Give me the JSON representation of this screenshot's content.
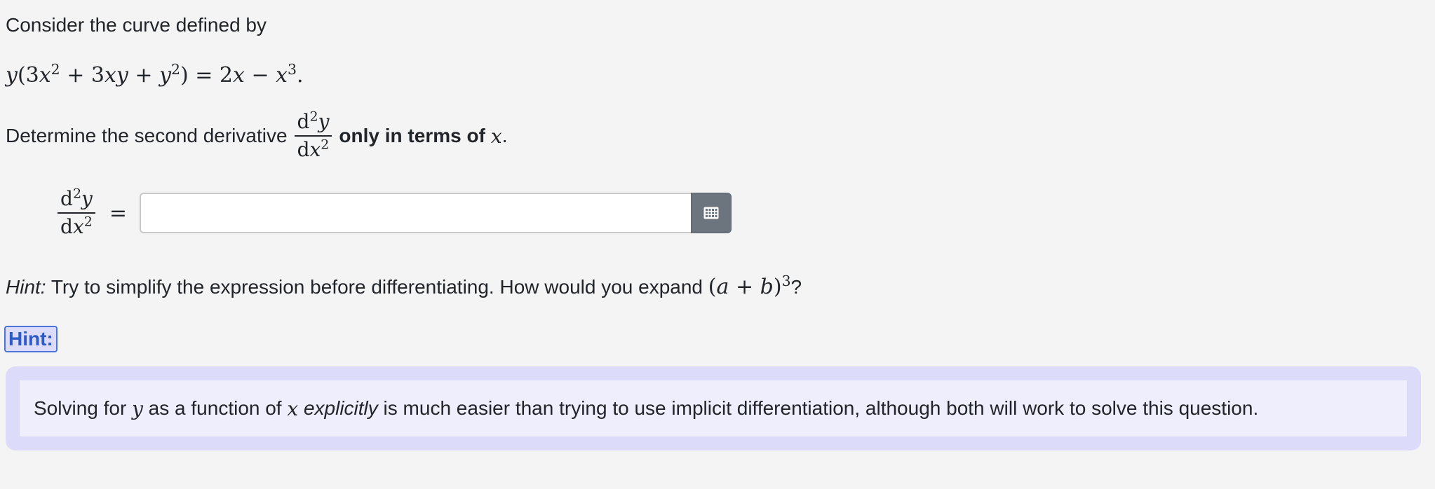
{
  "question": {
    "intro": "Consider the curve defined by",
    "equation": {
      "lhs_y": "y",
      "lhs_open": "(3",
      "x1": "x",
      "exp1": "2",
      "mid1": " + 3",
      "x2": "x",
      "y2": "y",
      "mid2": " + ",
      "y3": "y",
      "exp2": "2",
      "close": ") = 2",
      "x3": "x",
      "minus": " − ",
      "x4": "x",
      "exp3": "3",
      "period": "."
    },
    "instruction_prefix": "Determine the second derivative",
    "instruction_bold": "only in terms of",
    "instruction_var": "x",
    "instruction_suffix": "."
  },
  "derivative": {
    "num_d": "d",
    "num_exp": "2",
    "num_var": "y",
    "den_d": "d",
    "den_var": "x",
    "den_exp": "2"
  },
  "answer": {
    "equals": "=",
    "value": "",
    "placeholder": ""
  },
  "hint": {
    "label": "Hint:",
    "text": " Try to simplify the expression before differentiating. How would you expand ",
    "expr_open": "(",
    "a": "a",
    "plus": " + ",
    "b": "b",
    "expr_close": ")",
    "exp": "3",
    "end": "?"
  },
  "hint_toggle": {
    "label": "Hint:"
  },
  "hint_panel": {
    "p1": "Solving for ",
    "var_y": "y",
    "p2": " as a function of ",
    "var_x": "x",
    "p3": " ",
    "emph": "explicitly",
    "p4": " is much easier than trying to use implicit differentiation, although both will work to solve this question."
  },
  "icons": {
    "keyboard_button": "keyboard-icon"
  },
  "colors": {
    "accent_blue": "#2c5bc8",
    "hint_bg": "#dcdcfa",
    "button_gray": "#6c757d"
  }
}
